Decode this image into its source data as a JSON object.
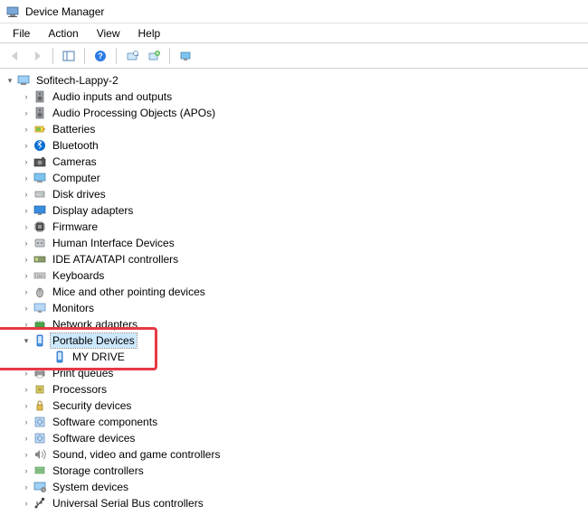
{
  "window": {
    "title": "Device Manager"
  },
  "menus": {
    "file": "File",
    "action": "Action",
    "view": "View",
    "help": "Help"
  },
  "root": {
    "label": "Sofitech-Lappy-2"
  },
  "categories": [
    {
      "label": "Audio inputs and outputs",
      "icon": "speaker",
      "expanded": false
    },
    {
      "label": "Audio Processing Objects (APOs)",
      "icon": "speaker",
      "expanded": false
    },
    {
      "label": "Batteries",
      "icon": "battery",
      "expanded": false
    },
    {
      "label": "Bluetooth",
      "icon": "bluetooth",
      "expanded": false
    },
    {
      "label": "Cameras",
      "icon": "camera",
      "expanded": false
    },
    {
      "label": "Computer",
      "icon": "computer",
      "expanded": false
    },
    {
      "label": "Disk drives",
      "icon": "disk",
      "expanded": false
    },
    {
      "label": "Display adapters",
      "icon": "display",
      "expanded": false
    },
    {
      "label": "Firmware",
      "icon": "chip",
      "expanded": false
    },
    {
      "label": "Human Interface Devices",
      "icon": "hid",
      "expanded": false
    },
    {
      "label": "IDE ATA/ATAPI controllers",
      "icon": "ide",
      "expanded": false
    },
    {
      "label": "Keyboards",
      "icon": "keyboard",
      "expanded": false
    },
    {
      "label": "Mice and other pointing devices",
      "icon": "mouse",
      "expanded": false
    },
    {
      "label": "Monitors",
      "icon": "monitor",
      "expanded": false
    },
    {
      "label": "Network adapters",
      "icon": "network",
      "expanded": false
    },
    {
      "label": "Portable Devices",
      "icon": "portable",
      "expanded": true,
      "selected": true,
      "children": [
        {
          "label": "MY DRIVE",
          "icon": "portable"
        }
      ]
    },
    {
      "label": "Print queues",
      "icon": "printer",
      "expanded": false
    },
    {
      "label": "Processors",
      "icon": "cpu",
      "expanded": false
    },
    {
      "label": "Security devices",
      "icon": "security",
      "expanded": false
    },
    {
      "label": "Software components",
      "icon": "software",
      "expanded": false
    },
    {
      "label": "Software devices",
      "icon": "software",
      "expanded": false
    },
    {
      "label": "Sound, video and game controllers",
      "icon": "sound",
      "expanded": false
    },
    {
      "label": "Storage controllers",
      "icon": "storage",
      "expanded": false
    },
    {
      "label": "System devices",
      "icon": "system",
      "expanded": false
    },
    {
      "label": "Universal Serial Bus controllers",
      "icon": "usb",
      "expanded": false
    }
  ],
  "highlight": {
    "ref": "Portable Devices"
  }
}
